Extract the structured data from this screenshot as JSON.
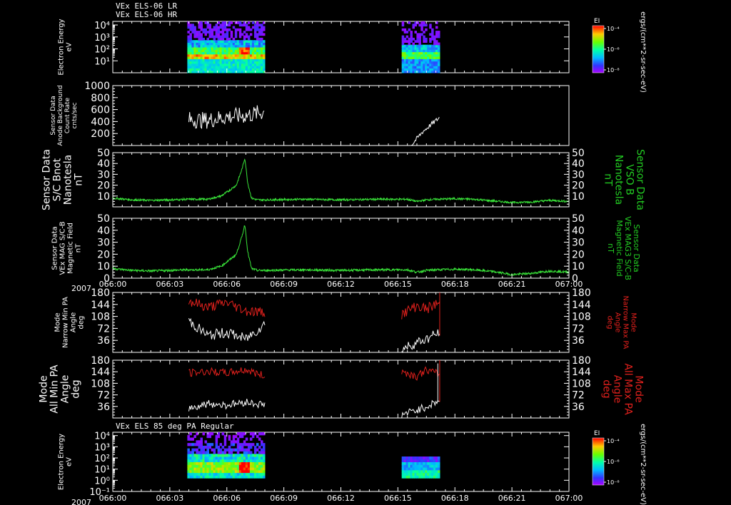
{
  "colors": {
    "background": "#000000",
    "axis": "#ffffff",
    "trace_white": "#ffffff",
    "trace_green": "#39e339",
    "trace_red": "#e0201c",
    "label_green": "#22cc22",
    "label_red": "#e0201c"
  },
  "colorbar": {
    "label": "EI",
    "unit_label": "ergs/(cm**2-sr-sec-eV)",
    "ticks": [
      "10⁻⁴",
      "10⁻⁶",
      "10⁻⁸"
    ]
  },
  "time_axis": {
    "year": "2007",
    "ticks": [
      "066:00",
      "066:03",
      "066:06",
      "066:09",
      "066:12",
      "066:15",
      "066:18",
      "066:21",
      "067:00"
    ]
  },
  "chart_data": [
    {
      "type": "heatmap",
      "titles": [
        "VEx ELS-06 LR",
        "VEx ELS-06 HR"
      ],
      "ylabel": [
        "Electron Energy",
        "eV"
      ],
      "yscale": "log",
      "ytick_labels": [
        "10⁴",
        "10³",
        "10²",
        "10¹"
      ],
      "yticks": [
        10000,
        1000,
        100,
        10
      ],
      "ylim": [
        1,
        20000
      ],
      "data_intervals": [
        [
          3.92,
          8.0
        ],
        [
          15.2,
          17.2
        ]
      ],
      "colorbar": "EI"
    },
    {
      "type": "line",
      "ylabel": [
        "Sensor Data",
        "Anode Background",
        "Count Rate",
        "cnts/sec"
      ],
      "ylim": [
        0,
        1000
      ],
      "yticks": [
        200,
        400,
        600,
        800,
        1000
      ],
      "series": [
        {
          "color": "white",
          "x": [
            4.0,
            5.0,
            6.0,
            7.0,
            8.0
          ],
          "y": [
            430,
            420,
            480,
            500,
            560
          ]
        },
        {
          "color": "white",
          "x": [
            15.7,
            16.3,
            17.2
          ],
          "y": [
            0,
            230,
            470
          ]
        }
      ]
    },
    {
      "type": "line",
      "ylabel": [
        "Sensor Data",
        "S/C Bnot",
        "Nanotesla",
        "nT"
      ],
      "ylabel_right": [
        "Sensor Data",
        "VSO B",
        "Nanotesla",
        "nT"
      ],
      "ylim": [
        0,
        50
      ],
      "yticks": [
        10,
        20,
        30,
        40,
        50
      ],
      "series": [
        {
          "color": "green",
          "x": [
            0,
            1,
            2,
            3,
            4,
            5,
            5.7,
            6.2,
            6.5,
            6.8,
            6.95,
            7.1,
            7.3,
            7.6,
            8,
            10,
            12,
            14,
            15.5,
            16,
            16.5,
            17,
            18,
            19,
            20,
            21,
            22,
            23,
            24
          ],
          "y": [
            8,
            6.5,
            6,
            6.5,
            7,
            7,
            10,
            16,
            20,
            35,
            45,
            22,
            8,
            6.5,
            6.5,
            7,
            6.5,
            7,
            7,
            5,
            6.5,
            7,
            7.5,
            7,
            5.5,
            4,
            4.5,
            6,
            5
          ]
        }
      ]
    },
    {
      "type": "line",
      "ylabel": [
        "Sensor Data",
        "VEx MAG S/C-B",
        "Magnetic Field",
        "nT"
      ],
      "ylabel_right": [
        "Sensor Data",
        "VEx MAG3 S/C-B",
        "Magnetic Field",
        "nT"
      ],
      "ylim": [
        0,
        50
      ],
      "yticks": [
        0,
        10,
        20,
        30,
        40,
        50
      ],
      "series": [
        {
          "color": "green",
          "x": [
            0,
            1,
            2,
            3,
            4,
            5,
            5.7,
            6.2,
            6.5,
            6.8,
            6.95,
            7.1,
            7.3,
            7.6,
            8,
            10,
            12,
            14,
            15.5,
            16,
            16.5,
            17,
            18,
            19,
            20,
            21,
            22,
            23,
            24
          ],
          "y": [
            8,
            6.5,
            6,
            6.5,
            7,
            7,
            10,
            16,
            20,
            35,
            45,
            22,
            8,
            6.5,
            6.5,
            7,
            6.5,
            7,
            7,
            5,
            6.5,
            7,
            7.5,
            7,
            5.5,
            3,
            4,
            6,
            5
          ]
        }
      ]
    },
    {
      "type": "line",
      "ylabel": [
        "Mode",
        "Narrow Min PA",
        "Angle",
        "deg"
      ],
      "ylabel_right": [
        "Mode",
        "Narrow Max PA",
        "Angle",
        "deg"
      ],
      "ylim": [
        0,
        180
      ],
      "yticks": [
        36,
        72,
        108,
        144,
        180
      ],
      "series": [
        {
          "color": "red",
          "x": [
            4.0,
            5.0,
            6.0,
            7.0,
            8.0
          ],
          "y": [
            155,
            135,
            150,
            125,
            120
          ]
        },
        {
          "color": "red",
          "x": [
            15.2,
            16.0,
            16.5,
            17.2
          ],
          "y": [
            115,
            140,
            130,
            150
          ]
        },
        {
          "color": "white",
          "x": [
            4.0,
            5.0,
            6.0,
            7.0,
            8.0
          ],
          "y": [
            95,
            50,
            60,
            40,
            85
          ]
        },
        {
          "color": "white",
          "x": [
            15.2,
            16.0,
            16.5,
            17.2
          ],
          "y": [
            10,
            30,
            40,
            60
          ]
        }
      ]
    },
    {
      "type": "line",
      "ylabel": [
        "Mode",
        "All Min PA",
        "Angle",
        "deg"
      ],
      "ylabel_right": [
        "Mode",
        "All Max PA",
        "Angle",
        "deg"
      ],
      "ylim": [
        0,
        180
      ],
      "yticks": [
        36,
        72,
        108,
        144,
        180
      ],
      "series": [
        {
          "color": "red",
          "x": [
            4.0,
            5.0,
            6.0,
            7.0,
            8.0
          ],
          "y": [
            140,
            145,
            140,
            150,
            130
          ]
        },
        {
          "color": "red",
          "x": [
            15.2,
            16.0,
            16.5,
            17.2
          ],
          "y": [
            145,
            130,
            150,
            135
          ]
        },
        {
          "color": "white",
          "x": [
            4.0,
            5.0,
            6.0,
            7.0,
            8.0
          ],
          "y": [
            30,
            45,
            40,
            50,
            40
          ]
        },
        {
          "color": "white",
          "x": [
            15.2,
            16.0,
            16.5,
            17.2
          ],
          "y": [
            10,
            25,
            35,
            55
          ]
        }
      ]
    },
    {
      "type": "heatmap",
      "titles": [
        "VEx ELS 85 deg PA Regular"
      ],
      "ylabel": [
        "Electron Energy",
        "eV"
      ],
      "yscale": "log",
      "ytick_labels": [
        "10⁴",
        "10³",
        "10²",
        "10¹",
        "10⁰",
        "10⁻¹"
      ],
      "yticks": [
        10000,
        1000,
        100,
        10,
        1,
        0.1
      ],
      "ylim": [
        0.1,
        20000
      ],
      "data_intervals": [
        [
          3.92,
          8.0
        ],
        [
          15.2,
          17.2
        ]
      ],
      "colorbar": "EI"
    }
  ]
}
